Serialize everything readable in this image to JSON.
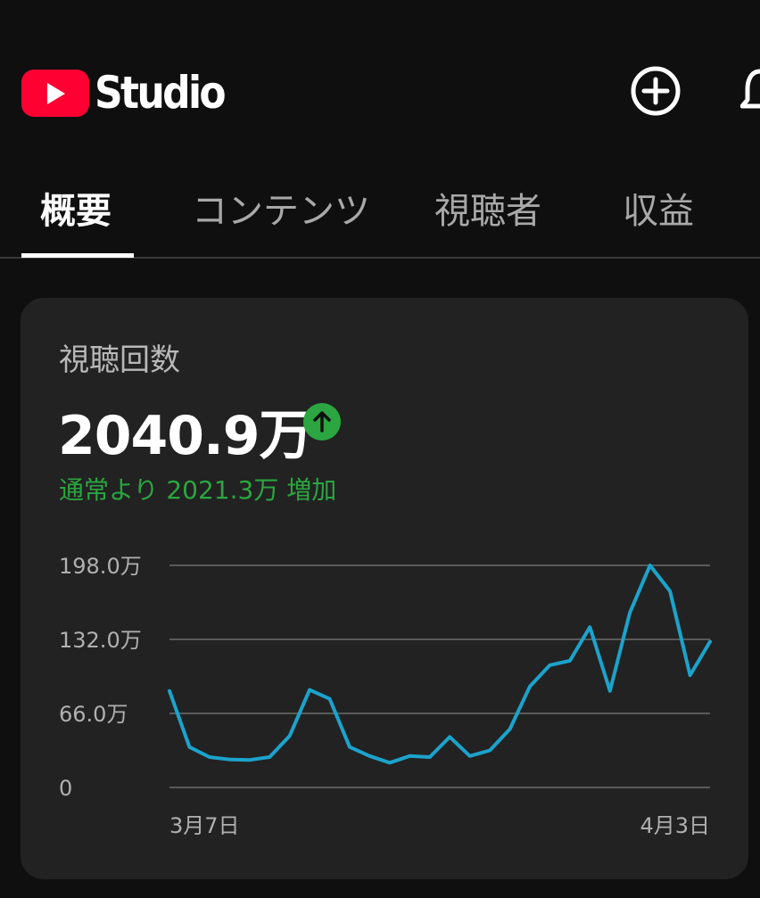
{
  "header": {
    "logo_text": "Studio",
    "create_icon": "plus-circle-icon",
    "notification_icon": "bell-icon"
  },
  "tabs": [
    {
      "label": "概要",
      "active": true
    },
    {
      "label": "コンテンツ",
      "active": false
    },
    {
      "label": "視聴者",
      "active": false
    },
    {
      "label": "収益",
      "active": false
    }
  ],
  "card": {
    "metric_label": "視聴回数",
    "metric_value": "2040.9万",
    "trend_icon": "arrow-up-icon",
    "note": "通常より 2021.3万 増加"
  },
  "colors": {
    "background": "#0f0f0f",
    "card": "#222222",
    "brand_red": "#ff0033",
    "positive_green": "#2ba640",
    "line": "#1ba3cc"
  },
  "chart_data": {
    "type": "line",
    "title": "",
    "xlabel": "",
    "ylabel": "",
    "x_tick_labels": [
      "3月7日",
      "4月3日"
    ],
    "y_tick_labels": [
      "0",
      "66.0万",
      "132.0万",
      "198.0万"
    ],
    "y_ticks": [
      0,
      66,
      132,
      198
    ],
    "ylim": [
      0,
      198
    ],
    "y_unit": "万",
    "grid": true,
    "series": [
      {
        "values": [
          86,
          36,
          27,
          25,
          24.5,
          27,
          46,
          87,
          79,
          36,
          28,
          22,
          28,
          27,
          45,
          28,
          33,
          52,
          90,
          109,
          113,
          143,
          86,
          156,
          198,
          175,
          100,
          130
        ]
      }
    ]
  }
}
